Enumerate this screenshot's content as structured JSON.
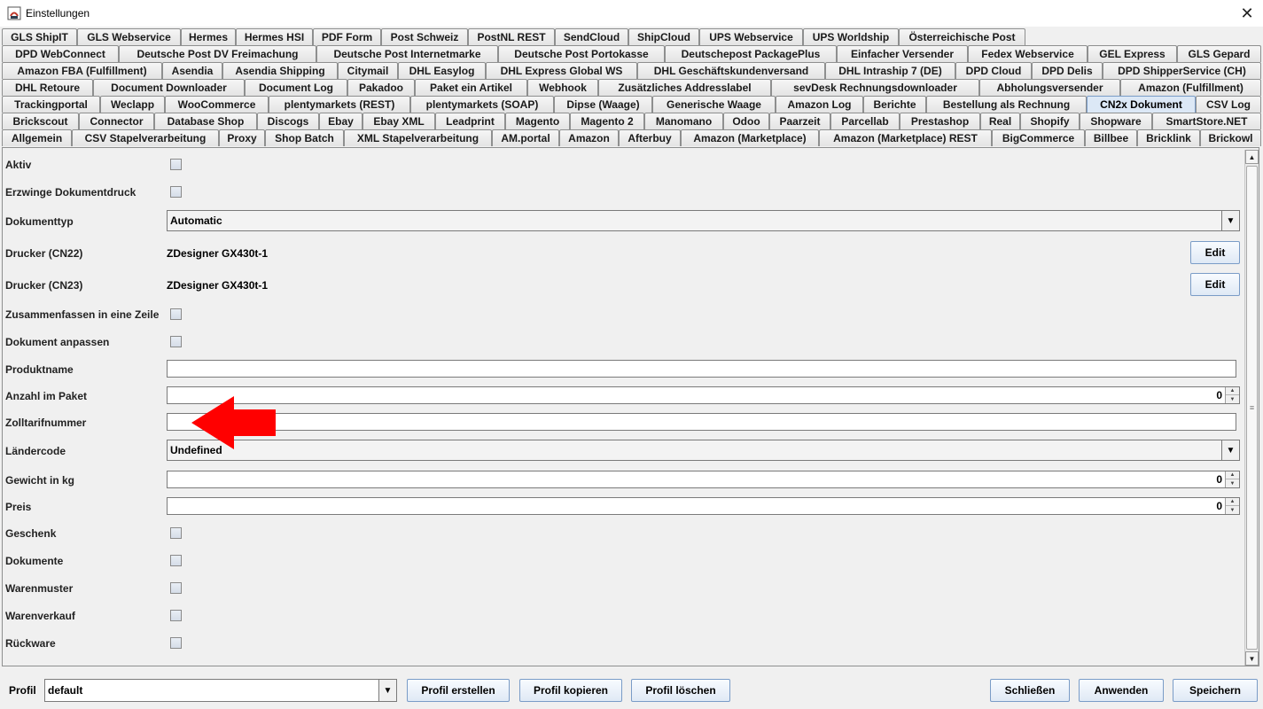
{
  "window": {
    "title": "Einstellungen"
  },
  "tabs": {
    "rows": [
      [
        "GLS ShipIT",
        "GLS Webservice",
        "Hermes",
        "Hermes HSI",
        "PDF Form",
        "Post Schweiz",
        "PostNL REST",
        "SendCloud",
        "ShipCloud",
        "UPS Webservice",
        "UPS Worldship",
        "Österreichische Post"
      ],
      [
        "DPD WebConnect",
        "Deutsche Post DV Freimachung",
        "Deutsche Post Internetmarke",
        "Deutsche Post Portokasse",
        "Deutschepost PackagePlus",
        "Einfacher Versender",
        "Fedex Webservice",
        "GEL Express",
        "GLS Gepard"
      ],
      [
        "Amazon FBA (Fulfillment)",
        "Asendia",
        "Asendia Shipping",
        "Citymail",
        "DHL Easylog",
        "DHL Express Global WS",
        "DHL Geschäftskundenversand",
        "DHL Intraship 7 (DE)",
        "DPD Cloud",
        "DPD Delis",
        "DPD ShipperService (CH)"
      ],
      [
        "DHL Retoure",
        "Document Downloader",
        "Document Log",
        "Pakadoo",
        "Paket ein Artikel",
        "Webhook",
        "Zusätzliches Addresslabel",
        "sevDesk Rechnungsdownloader",
        "Abholungsversender",
        "Amazon (Fulfillment)"
      ],
      [
        "Trackingportal",
        "Weclapp",
        "WooCommerce",
        "plentymarkets (REST)",
        "plentymarkets (SOAP)",
        "Dipse (Waage)",
        "Generische Waage",
        "Amazon Log",
        "Berichte",
        "Bestellung als Rechnung",
        "CN2x Dokument",
        "CSV Log"
      ],
      [
        "Brickscout",
        "Connector",
        "Database Shop",
        "Discogs",
        "Ebay",
        "Ebay XML",
        "Leadprint",
        "Magento",
        "Magento 2",
        "Manomano",
        "Odoo",
        "Paarzeit",
        "Parcellab",
        "Prestashop",
        "Real",
        "Shopify",
        "Shopware",
        "SmartStore.NET"
      ],
      [
        "Allgemein",
        "CSV Stapelverarbeitung",
        "Proxy",
        "Shop Batch",
        "XML Stapelverarbeitung",
        "AM.portal",
        "Amazon",
        "Afterbuy",
        "Amazon (Marketplace)",
        "Amazon (Marketplace) REST",
        "BigCommerce",
        "Billbee",
        "Bricklink",
        "Brickowl"
      ]
    ],
    "selected": "CN2x Dokument"
  },
  "form": {
    "aktiv": {
      "label": "Aktiv",
      "checked": false
    },
    "erzwinge": {
      "label": "Erzwinge Dokumentdruck",
      "checked": false
    },
    "dokumenttyp": {
      "label": "Dokumenttyp",
      "value": "Automatic"
    },
    "drucker22": {
      "label": "Drucker (CN22)",
      "value": "ZDesigner GX430t-1",
      "button": "Edit"
    },
    "drucker23": {
      "label": "Drucker (CN23)",
      "value": "ZDesigner GX430t-1",
      "button": "Edit"
    },
    "zusammenfassen": {
      "label": "Zusammenfassen in eine Zeile",
      "checked": false
    },
    "anpassen": {
      "label": "Dokument anpassen",
      "checked": false
    },
    "produktname": {
      "label": "Produktname",
      "value": ""
    },
    "anzahl": {
      "label": "Anzahl im Paket",
      "value": "0"
    },
    "zolltarif": {
      "label": "Zolltarifnummer",
      "value": ""
    },
    "laendercode": {
      "label": "Ländercode",
      "value": "Undefined"
    },
    "gewicht": {
      "label": "Gewicht in kg",
      "value": "0"
    },
    "preis": {
      "label": "Preis",
      "value": "0"
    },
    "geschenk": {
      "label": "Geschenk",
      "checked": false
    },
    "dokumente": {
      "label": "Dokumente",
      "checked": false
    },
    "warenmuster": {
      "label": "Warenmuster",
      "checked": false
    },
    "warenverkauf": {
      "label": "Warenverkauf",
      "checked": false
    },
    "rueckware": {
      "label": "Rückware",
      "checked": false
    }
  },
  "bottom": {
    "profil_label": "Profil",
    "profil_value": "default",
    "profil_erstellen": "Profil erstellen",
    "profil_kopieren": "Profil kopieren",
    "profil_loeschen": "Profil löschen",
    "schliessen": "Schließen",
    "anwenden": "Anwenden",
    "speichern": "Speichern"
  },
  "colors": {
    "arrow": "#ff0000",
    "selected_tab": "#dce8f6"
  }
}
